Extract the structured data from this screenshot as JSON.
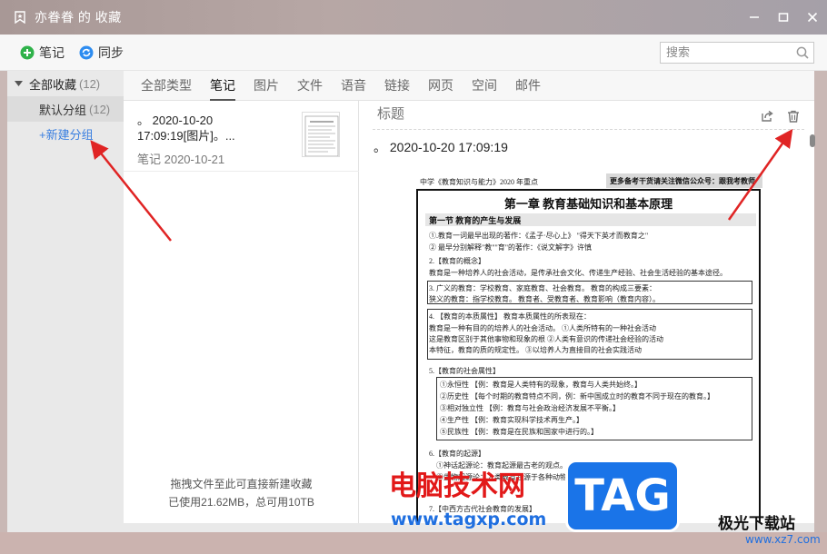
{
  "window": {
    "title": "亦眷眷 的 收藏"
  },
  "toolbar": {
    "note_label": "笔记",
    "sync_label": "同步",
    "search_placeholder": "搜索"
  },
  "sidebar": {
    "root_label": "全部收藏",
    "root_count": "(12)",
    "items": [
      {
        "label": "默认分组",
        "count": "(12)"
      }
    ],
    "new_group_label": "+新建分组"
  },
  "tabs": [
    "全部类型",
    "笔记",
    "图片",
    "文件",
    "语音",
    "链接",
    "网页",
    "空间",
    "邮件"
  ],
  "active_tab": "笔记",
  "list": {
    "items": [
      {
        "text_line1": "。 2020-10-20",
        "text_line2": "17:09:19[图片]。...",
        "date": "笔记 2020-10-21"
      }
    ],
    "drop_hint": "拖拽文件至此可直接新建收藏",
    "usage": "已使用21.62MB，总可用10TB"
  },
  "detail": {
    "title_placeholder": "标题",
    "body_text": "。 2020-10-20 17:09:19",
    "document": {
      "header_left": "中学《教育知识与能力》2020 年重点",
      "header_right": "更多备考干货请关注微信公众号：跟我考教师",
      "chapter": "第一章 教育基础知识和基本原理",
      "section": "第一节 教育的产生与发展",
      "lines": [
        "①.教育一词最早出现的著作：《孟子·尽心上》 \"得天下英才而教育之\"",
        "② 最早分别解释\"教\"\"育\"的著作：《说文解字》许慎",
        "2.【教育的概念】",
        "教育是一种培养人的社会活动，是传承社会文化、传递生产经验、社会生活经验的基本途径。",
        "3.  广义的教育：学校教育、家庭教育、社会教育。  教育的构成三要素：",
        "    狭义的教育：指学校教育。                   教育者、受教育者、教育影响（教育内容）。",
        "4. 【教育的本质属性】                         教育本质属性的所表现在：",
        "教育是一种有目的的培养人的社会活动。          ①人类所特有的一种社会活动",
        "这是教育区别于其他事物和现象的根              ②人类有意识的传递社会经验的活动",
        "本特征，教育的质的规定性。                    ③以培养人为直接目的社会实践活动",
        "5.【教育的社会属性】",
        "①永恒性    【例：教育是人类特有的现象，教育与人类共始终。】",
        "②历史性    【每个时期的教育特点不同，例：新中国成立时的教育不同于现在的教育。】",
        "③相对独立性  【例：教育与社会政治经济发展不平衡。】",
        "④生产性    【例：教育实现科学技术再生产。】",
        "⑤民族性    【例：教育是在民族和国家中进行的。】",
        "6.【教育的起源】",
        "①神话起源论：教育起源最古老的观点。",
        "②生物起源论：人类教育起源于各种动物的本能活动。",
        "7.【中西方古代社会教育的发展】"
      ]
    }
  },
  "watermarks": {
    "cn_text": "电脑技术网",
    "url": "www.tagxp.com",
    "tag": "TAG",
    "site": "极光下载站",
    "site_url": "www.xz7.com"
  },
  "colors": {
    "accent_blue": "#3a7fe0",
    "add_green": "#2fb24a",
    "arrow_red": "#e02424"
  }
}
